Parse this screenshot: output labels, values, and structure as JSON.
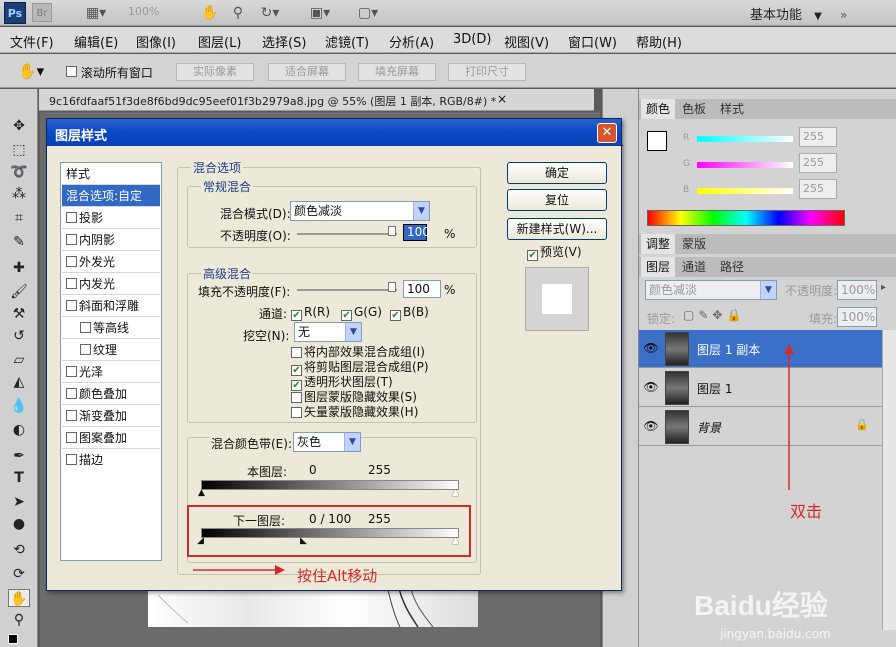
{
  "app": {
    "logo": "Ps",
    "bridge_logo": "Br",
    "zoom": "100%",
    "workspace": "基本功能"
  },
  "menu": [
    "文件(F)",
    "编辑(E)",
    "图像(I)",
    "图层(L)",
    "选择(S)",
    "滤镜(T)",
    "分析(A)",
    "3D(D)",
    "视图(V)",
    "窗口(W)",
    "帮助(H)"
  ],
  "options": {
    "scroll_all": "滚动所有窗口",
    "actual_pixels": "实际像素",
    "fit_screen": "适合屏幕",
    "fill_screen": "填充屏幕",
    "print_size": "打印尺寸"
  },
  "document": {
    "title": "9c16fdfaaf51f3de8f6bd9dc95eef01f3b2979a8.jpg @ 55% (图层 1 副本, RGB/8#) *",
    "close": "×"
  },
  "color_panel": {
    "tabs": [
      "颜色",
      "色板",
      "样式"
    ],
    "channels": [
      {
        "label": "R",
        "value": "255"
      },
      {
        "label": "G",
        "value": "255"
      },
      {
        "label": "B",
        "value": "255"
      }
    ]
  },
  "adjust_panel": {
    "tabs": [
      "调整",
      "蒙版"
    ]
  },
  "layers_panel": {
    "tabs": [
      "图层",
      "通道",
      "路径"
    ],
    "blend_mode": "颜色减淡",
    "opacity_label": "不透明度:",
    "opacity": "100%",
    "lock_label": "锁定:",
    "fill_label": "填充:",
    "fill": "100%",
    "layers": [
      {
        "name": "图层 1 副本",
        "selected": true
      },
      {
        "name": "图层 1",
        "selected": false
      },
      {
        "name": "背景",
        "selected": false,
        "locked": true
      }
    ]
  },
  "dialog": {
    "title": "图层样式",
    "close": "✕",
    "styles_header": "样式",
    "styles": [
      {
        "label": "混合选项:自定",
        "checkbox": false,
        "selected": true,
        "indent": false
      },
      {
        "label": "投影",
        "checkbox": true,
        "indent": false
      },
      {
        "label": "内阴影",
        "checkbox": true,
        "indent": false
      },
      {
        "label": "外发光",
        "checkbox": true,
        "indent": false
      },
      {
        "label": "内发光",
        "checkbox": true,
        "indent": false
      },
      {
        "label": "斜面和浮雕",
        "checkbox": true,
        "indent": false
      },
      {
        "label": "等高线",
        "checkbox": true,
        "indent": true
      },
      {
        "label": "纹理",
        "checkbox": true,
        "indent": true
      },
      {
        "label": "光泽",
        "checkbox": true,
        "indent": false
      },
      {
        "label": "颜色叠加",
        "checkbox": true,
        "indent": false
      },
      {
        "label": "渐变叠加",
        "checkbox": true,
        "indent": false
      },
      {
        "label": "图案叠加",
        "checkbox": true,
        "indent": false
      },
      {
        "label": "描边",
        "checkbox": true,
        "indent": false
      }
    ],
    "blend_options_title": "混合选项",
    "general_title": "常规混合",
    "blend_mode_label": "混合模式(D):",
    "blend_mode": "颜色减淡",
    "opacity_label": "不透明度(O):",
    "opacity": "100",
    "percent": "%",
    "advanced_title": "高级混合",
    "fill_opacity_label": "填充不透明度(F):",
    "fill_opacity": "100",
    "channels_label": "通道:",
    "channels": [
      "R(R)",
      "G(G)",
      "B(B)"
    ],
    "knockout_label": "挖空(N):",
    "knockout": "无",
    "options": [
      {
        "label": "将内部效果混合成组(I)",
        "checked": false
      },
      {
        "label": "将剪贴图层混合成组(P)",
        "checked": true
      },
      {
        "label": "透明形状图层(T)",
        "checked": true
      },
      {
        "label": "图层蒙版隐藏效果(S)",
        "checked": false
      },
      {
        "label": "矢量蒙版隐藏效果(H)",
        "checked": false
      }
    ],
    "blend_if_label": "混合颜色带(E):",
    "blend_if": "灰色",
    "this_layer_label": "本图层:",
    "this_layer_low": "0",
    "this_layer_high": "255",
    "underlying_label": "下一图层:",
    "underlying_values": "0 / 100",
    "underlying_high": "255",
    "ok": "确定",
    "cancel": "复位",
    "new_style": "新建样式(W)...",
    "preview": "预览(V)"
  },
  "annotations": {
    "alt_move": "按住Alt移动",
    "double_click": "双击",
    "color": "#d42a2a"
  },
  "watermark": {
    "brand": "Baidu经验",
    "url": "jingyan.baidu.com"
  }
}
